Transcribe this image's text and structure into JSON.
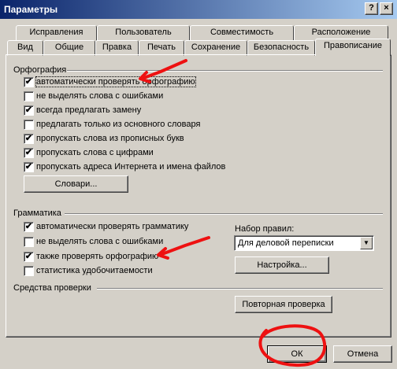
{
  "window": {
    "title": "Параметры",
    "help_label": "?",
    "close_label": "×"
  },
  "tabs_row1": [
    {
      "label": "Исправления"
    },
    {
      "label": "Пользователь"
    },
    {
      "label": "Совместимость"
    },
    {
      "label": "Расположение"
    }
  ],
  "tabs_row2": [
    {
      "label": "Вид"
    },
    {
      "label": "Общие"
    },
    {
      "label": "Правка"
    },
    {
      "label": "Печать"
    },
    {
      "label": "Сохранение"
    },
    {
      "label": "Безопасность"
    },
    {
      "label": "Правописание",
      "active": true
    }
  ],
  "spelling": {
    "title": "Орфография",
    "options": [
      {
        "label": "автоматически проверять орфографию",
        "checked": true
      },
      {
        "label": "не выделять слова с ошибками",
        "checked": false
      },
      {
        "label": "всегда предлагать замену",
        "checked": true
      },
      {
        "label": "предлагать только из основного словаря",
        "checked": false
      },
      {
        "label": "пропускать слова из прописных букв",
        "checked": true
      },
      {
        "label": "пропускать слова с цифрами",
        "checked": true
      },
      {
        "label": "пропускать адреса Интернета и имена файлов",
        "checked": true
      }
    ],
    "dictionaries_button": "Словари..."
  },
  "grammar": {
    "title": "Грамматика",
    "options": [
      {
        "label": "автоматически проверять грамматику",
        "checked": true
      },
      {
        "label": "не выделять слова с ошибками",
        "checked": false
      },
      {
        "label": "также проверять орфографию",
        "checked": true
      },
      {
        "label": "статистика удобочитаемости",
        "checked": false
      }
    ],
    "ruleset_label": "Набор правил:",
    "ruleset_value": "Для деловой переписки",
    "settings_button": "Настройка..."
  },
  "proofing": {
    "title": "Средства проверки",
    "recheck_button": "Повторная проверка"
  },
  "footer": {
    "ok_label": "ОК",
    "cancel_label": "Отмена"
  },
  "check_mark": "✔",
  "colors": {
    "annotation": "#ee1111",
    "title_start": "#0a246a",
    "title_end": "#a6caf0"
  }
}
